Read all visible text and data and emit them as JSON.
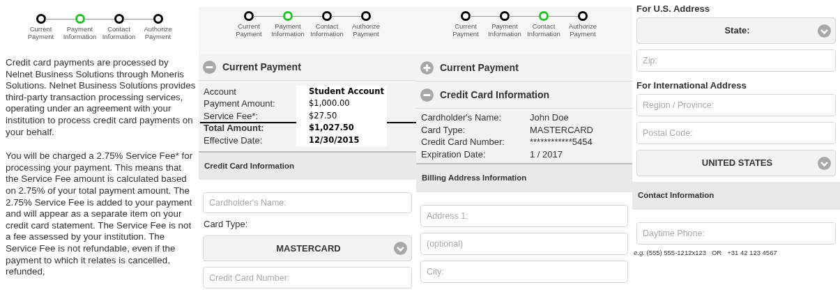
{
  "panels": [
    {
      "steps": [
        {
          "label": "Current Payment",
          "selected": false
        },
        {
          "label": "Payment Information",
          "selected": true
        },
        {
          "label": "Contact Information",
          "selected": false
        },
        {
          "label": "Authorize Payment",
          "selected": false
        }
      ],
      "blocks": [
        {
          "kind": "paragraph",
          "text": "Credit card payments are processed by Nelnet Business Solutions through Moneris Solutions. Nelnet Business Solutions provides third-party transaction processing services, operating under an agreement with your institution to process credit card payments on your behalf."
        },
        {
          "kind": "paragraph",
          "text": "You will be charged a 2.75% Service Fee* for processing your payment. This means that the Service Fee amount is calculated based on 2.75% of your total payment amount. The 2.75% Service Fee is added to your payment and will appear as a separate item on your credit card statement. The Service Fee is not a fee assessed by your institution. The Service Fee is not refundable, even if the payment to which it relates is cancelled, refunded,"
        }
      ]
    },
    {
      "steps": [
        {
          "label": "Current Payment",
          "selected": false
        },
        {
          "label": "Payment Information",
          "selected": true
        },
        {
          "label": "Contact Information",
          "selected": false
        },
        {
          "label": "Authorize Payment",
          "selected": false
        }
      ],
      "blocks": [
        {
          "kind": "accordion",
          "title": "Current Payment",
          "expanded": true
        },
        {
          "kind": "details",
          "overlay": true,
          "rows": [
            {
              "label": "Account",
              "value": "Student Account",
              "bold": false,
              "value_bold": true,
              "rule_below": false
            },
            {
              "label": "Payment Amount:",
              "value": "$1,000.00",
              "bold": false,
              "value_bold": false,
              "rule_below": false
            },
            {
              "label": "Service Fee*:",
              "value": "$27.50",
              "bold": false,
              "value_bold": false,
              "rule_below": true
            },
            {
              "label": "Total Amount:",
              "value": "$1,027.50",
              "bold": true,
              "value_bold": true,
              "rule_below": false
            },
            {
              "label": "Effective Date:",
              "value": "12/30/2015",
              "bold": false,
              "value_bold": true,
              "rule_below": false
            }
          ]
        },
        {
          "kind": "section",
          "title": "Credit Card Information"
        },
        {
          "kind": "input",
          "placeholder": "Cardholder's Name:"
        },
        {
          "kind": "label",
          "text": "Card Type:"
        },
        {
          "kind": "select",
          "value": "MASTERCARD"
        },
        {
          "kind": "input",
          "placeholder": "Credit Card Number:"
        }
      ]
    },
    {
      "steps": [
        {
          "label": "Current Payment",
          "selected": false
        },
        {
          "label": "Payment Information",
          "selected": false
        },
        {
          "label": "Contact Information",
          "selected": true
        },
        {
          "label": "Authorize Payment",
          "selected": false
        }
      ],
      "blocks": [
        {
          "kind": "accordion",
          "title": "Current Payment",
          "expanded": false
        },
        {
          "kind": "accordion",
          "title": "Credit Card Information",
          "expanded": true
        },
        {
          "kind": "details",
          "overlay": false,
          "rows": [
            {
              "label": "Cardholder's Name:",
              "value": "John Doe",
              "bold": false,
              "value_bold": false
            },
            {
              "label": "Card Type:",
              "value": "MASTERCARD",
              "bold": false,
              "value_bold": false
            },
            {
              "label": "Credit Card Number:",
              "value": "************5454",
              "bold": false,
              "value_bold": false
            },
            {
              "label": "Expiration Date:",
              "value": "1 / 2017",
              "bold": false,
              "value_bold": false
            }
          ]
        },
        {
          "kind": "section",
          "title": "Billing Address Information"
        },
        {
          "kind": "input",
          "placeholder": "Address 1:"
        },
        {
          "kind": "input",
          "placeholder": "(optional)"
        },
        {
          "kind": "input",
          "placeholder": "City:"
        }
      ]
    },
    {
      "blocks": [
        {
          "kind": "heading",
          "text": "For U.S. Address"
        },
        {
          "kind": "select",
          "value": "State:"
        },
        {
          "kind": "input",
          "placeholder": "Zip:"
        },
        {
          "kind": "heading",
          "text": "For International Address"
        },
        {
          "kind": "input",
          "placeholder": "Region / Province:"
        },
        {
          "kind": "input",
          "placeholder": "Postal Code:"
        },
        {
          "kind": "select",
          "value": "UNITED STATES"
        },
        {
          "kind": "section",
          "title": "Contact Information"
        },
        {
          "kind": "input",
          "placeholder": "Daytime Phone:"
        },
        {
          "kind": "hint",
          "text": "e.g. (555) 555-1212x123   OR   +31 42 123 4567"
        }
      ]
    }
  ]
}
